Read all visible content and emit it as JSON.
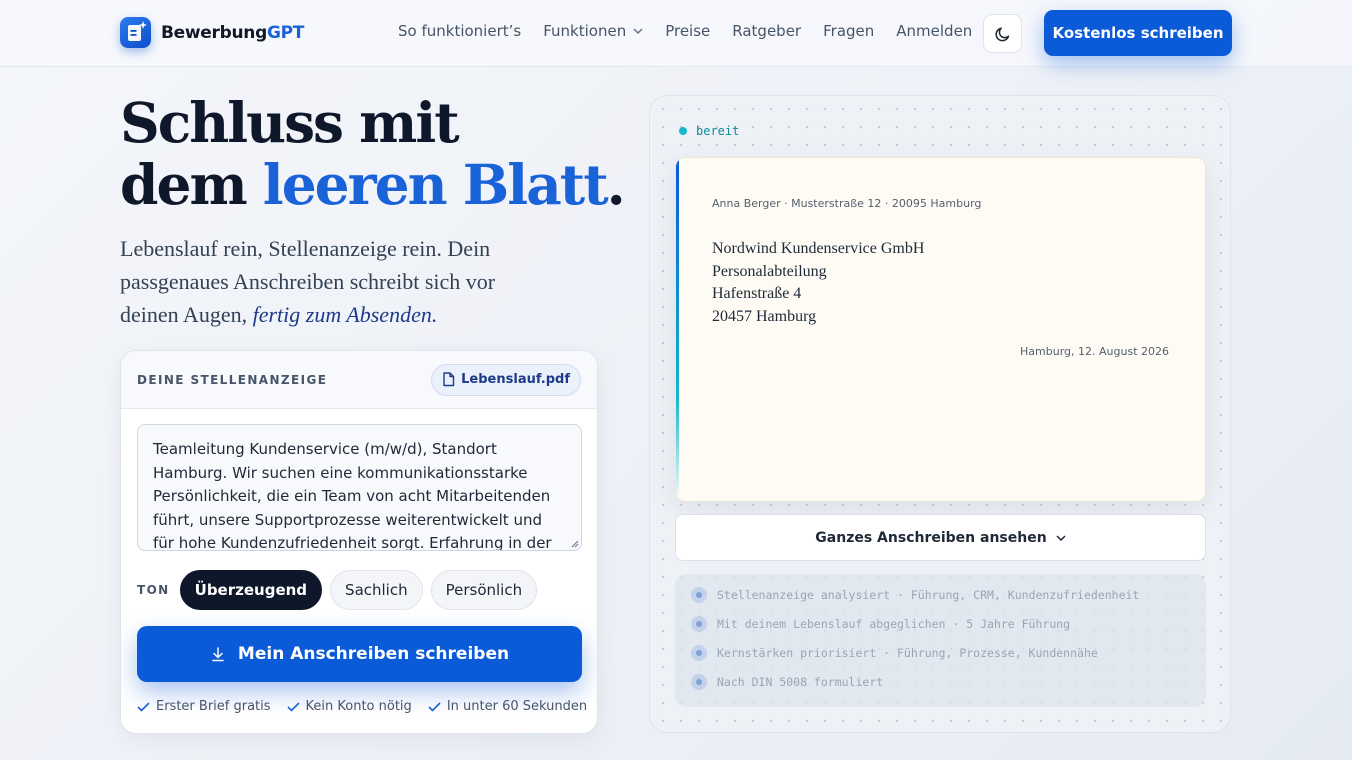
{
  "header": {
    "logo_text": "Bewerbung",
    "logo_accent": "GPT",
    "nav": [
      "So funktioniert’s",
      "Funktionen",
      "Preise",
      "Ratgeber",
      "Fragen",
      "Anmelden"
    ],
    "cta_label": "Kostenlos schreiben"
  },
  "hero": {
    "title_line1": "Schluss mit",
    "title_line2_start": "dem ",
    "title_line2_accent": "leeren Blatt",
    "title_line2_end": ".",
    "subtitle": "Lebenslauf rein, Stellenanzeige rein. Dein passgenaues Anschreiben schreibt sich vor deinen Augen, ",
    "subtitle_emphasis": "fertig zum Absenden."
  },
  "form": {
    "label": "DEINE STELLENANZEIGE",
    "file_chip": "Lebenslauf.pdf",
    "job_text": "Teamleitung Kundenservice (m/w/d), Standort Hamburg. Wir suchen eine kommunikationsstarke Persönlichkeit, die ein Team von acht Mitarbeitenden führt, unsere Supportprozesse weiterentwickelt und für hohe Kundenzufriedenheit sorgt. Erfahrung in der",
    "tone_label": "TON",
    "tones": [
      "Überzeugend",
      "Sachlich",
      "Persönlich"
    ],
    "selected_tone": "Überzeugend",
    "submit_label": "Mein Anschreiben schreiben",
    "checks": [
      "Erster Brief gratis",
      "Kein Konto nötig",
      "In unter 60 Sekunden"
    ]
  },
  "preview": {
    "status": "bereit",
    "sender": "Anna Berger · Musterstraße 12 · 20095 Hamburg",
    "recipient": [
      "Nordwind Kundenservice GmbH",
      "Personalabteilung",
      "Hafenstraße 4",
      "20457 Hamburg"
    ],
    "date": "Hamburg, 12. August 2026",
    "view_label": "Ganzes Anschreiben ansehen",
    "steps": [
      "Stellenanzeige analysiert · Führung, CRM, Kundenzufriedenheit",
      "Mit deinem Lebenslauf abgeglichen · 5 Jahre Führung",
      "Kernstärken priorisiert · Führung, Prozesse, Kundennähe",
      "Nach DIN 5008 formuliert"
    ]
  },
  "colors": {
    "brand": "#0b5ad8",
    "accent_text": "#1a62d8",
    "dark": "#0f172a",
    "status": "#14b8c8"
  },
  "icons": [
    "logo-mark-icon",
    "chevron-down-icon",
    "moon-icon",
    "file-icon",
    "download-arrow-icon",
    "check-icon",
    "resize-handle-icon"
  ]
}
